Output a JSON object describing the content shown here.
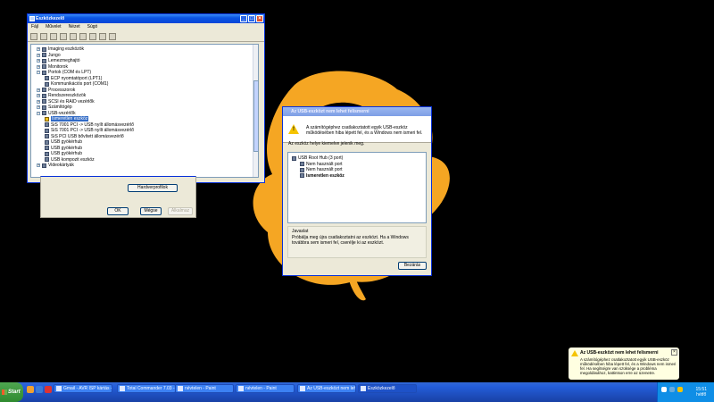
{
  "devmgr": {
    "title": "Eszközkezelő",
    "menu": [
      "Fájl",
      "Művelet",
      "Nézet",
      "Súgó"
    ],
    "toolbar_icons": [
      "back-icon",
      "forward-icon",
      "view-icon",
      "properties-icon",
      "print-icon",
      "help-icon",
      "scan-icon",
      "update-icon",
      "remove-icon"
    ],
    "tree": [
      {
        "label": "Imaging eszközök",
        "level": 1,
        "expand": "+"
      },
      {
        "label": "Jungo",
        "level": 1,
        "expand": "+"
      },
      {
        "label": "Lemezmeghajtó",
        "level": 1,
        "expand": "+"
      },
      {
        "label": "Monitorok",
        "level": 1,
        "expand": "+"
      },
      {
        "label": "Portok (COM és LPT)",
        "level": 1,
        "expand": "−"
      },
      {
        "label": "ECP nyomtatóport (LPT1)",
        "level": 2,
        "expand": ""
      },
      {
        "label": "Kommunikációs port (COM1)",
        "level": 2,
        "expand": ""
      },
      {
        "label": "Processzorok",
        "level": 1,
        "expand": "+"
      },
      {
        "label": "Rendszereszközök",
        "level": 1,
        "expand": "+"
      },
      {
        "label": "SCSI és RAID vezérlők",
        "level": 1,
        "expand": "+"
      },
      {
        "label": "Számítógép",
        "level": 1,
        "expand": "+"
      },
      {
        "label": "USB-vezérlők",
        "level": 1,
        "expand": "−"
      },
      {
        "label": "Ismeretlen eszköz",
        "level": 2,
        "expand": "",
        "selected": true,
        "warn": true
      },
      {
        "label": "SiS 7001 PCI -> USB nyílt állomásvezérlő",
        "level": 2,
        "expand": ""
      },
      {
        "label": "SiS 7001 PCI -> USB nyílt állomásvezérlő",
        "level": 2,
        "expand": ""
      },
      {
        "label": "SiS PCI USB bővített állomásvezérlő",
        "level": 2,
        "expand": ""
      },
      {
        "label": "USB gyökérhub",
        "level": 2,
        "expand": ""
      },
      {
        "label": "USB gyökérhub",
        "level": 2,
        "expand": ""
      },
      {
        "label": "USB gyökérhub",
        "level": 2,
        "expand": ""
      },
      {
        "label": "USB kompozit eszköz",
        "level": 2,
        "expand": ""
      },
      {
        "label": "Videokártyák",
        "level": 1,
        "expand": "+"
      }
    ]
  },
  "props": {
    "hardware_button": "Hardverprofilok",
    "ok_button": "OK",
    "cancel_button": "Mégse",
    "apply_button": "Alkalmaz"
  },
  "usbdlg": {
    "title": "Az USB-eszközt nem lehet felismerni",
    "message": "A számítógéphez csatlakoztatott egyik USB-eszköz működésében hiba lépett fel, és a Windows nem ismeri fel.",
    "sub": "Az eszköz helye kiemelve jelenik meg.",
    "hub_tree": [
      {
        "label": "USB Root Hub (3 port)",
        "level": 0,
        "bold": false
      },
      {
        "label": "Nem használt port",
        "level": 1,
        "bold": false
      },
      {
        "label": "Nem használt port",
        "level": 1,
        "bold": false
      },
      {
        "label": "Ismeretlen eszköz",
        "level": 1,
        "bold": true
      }
    ],
    "group_title": "Javaslat",
    "suggestion": "Próbálja meg újra csatlakoztatni az eszközt. Ha a Windows továbbra sem ismeri fel, cserélje ki az eszközt.",
    "close_button": "Bezárás"
  },
  "taskbar": {
    "start": "Start",
    "tasks": [
      {
        "label": "Gmail - AVR ISP kártás - ...",
        "active": false
      },
      {
        "label": "Total Commander 7.03 - ...",
        "active": false
      },
      {
        "label": "névtelen - Paint",
        "active": false
      },
      {
        "label": "névtelen - Paint",
        "active": false
      },
      {
        "label": "Az USB-eszközt nem lehe...",
        "active": false
      },
      {
        "label": "Eszközkezelő",
        "active": true
      }
    ],
    "time": "15:51",
    "day": "hétfő"
  },
  "balloon": {
    "title": "Az USB-eszközt nem lehet felismerni",
    "text": "A számítógéphez csatlakoztatott egyik USB-eszköz működésében hiba lépett fel, és a Windows nem ismeri fel. Ha segítségre van szüksége a probléma megoldásához, kattintson erre az üzenetre."
  },
  "colors": {
    "wallpaper_bg": "#000000",
    "wallpaper_shape": "#f5a623",
    "xp_blue": "#0a54e3",
    "taskbar": "#245edb",
    "balloon": "#ffffe1"
  }
}
